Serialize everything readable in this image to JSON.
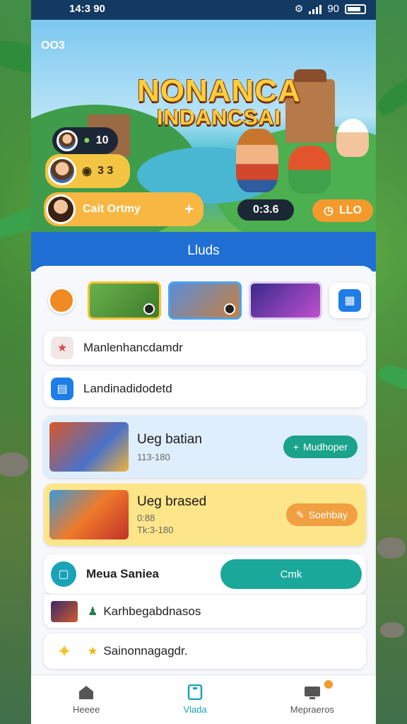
{
  "status_bar": {
    "time": "14:3 90",
    "right_text": "90"
  },
  "hero": {
    "corner_badge": "OO3",
    "title_line1": "NONANCA",
    "title_line2": "INDANCSAI",
    "stat1": "10",
    "stat2": "3 3",
    "profile_button": "Cait Ortmy",
    "profile_plus": "+",
    "chip_left": "0:3.6",
    "chip_right": "LLO"
  },
  "section_band": {
    "title": "Lluds"
  },
  "menu_rows": [
    {
      "label": "Manlenhancdamdr",
      "icon": "star-icon",
      "color": "#d84a4a"
    },
    {
      "label": "Landinadidodetd",
      "icon": "document-icon",
      "color": "#1e7de6"
    }
  ],
  "games": [
    {
      "name": "Ueg batian",
      "meta1": "113-180",
      "meta2": "",
      "action": "Mudhoper",
      "bg": "#dfeefc",
      "action_color": "#1aa38a"
    },
    {
      "name": "Ueg brased",
      "meta1": "0:88",
      "meta2": "Tk:3-180",
      "action": "Soehbay",
      "bg": "#fde58a",
      "action_color": "#f0a040"
    }
  ],
  "bottom_rows": {
    "meua_label": "Meua Saniea",
    "meua_button": "Cmk",
    "row2_label": "Karhbegabdnasos",
    "row3_label": "Sainonnagagdr."
  },
  "tabs": [
    {
      "label": "Heeee",
      "icon": "home-icon"
    },
    {
      "label": "Vlada",
      "icon": "tablet-icon"
    },
    {
      "label": "Mepraeros",
      "icon": "monitor-icon"
    }
  ],
  "colors": {
    "accent": "#1f6fd4",
    "teal": "#1aa3b8"
  }
}
